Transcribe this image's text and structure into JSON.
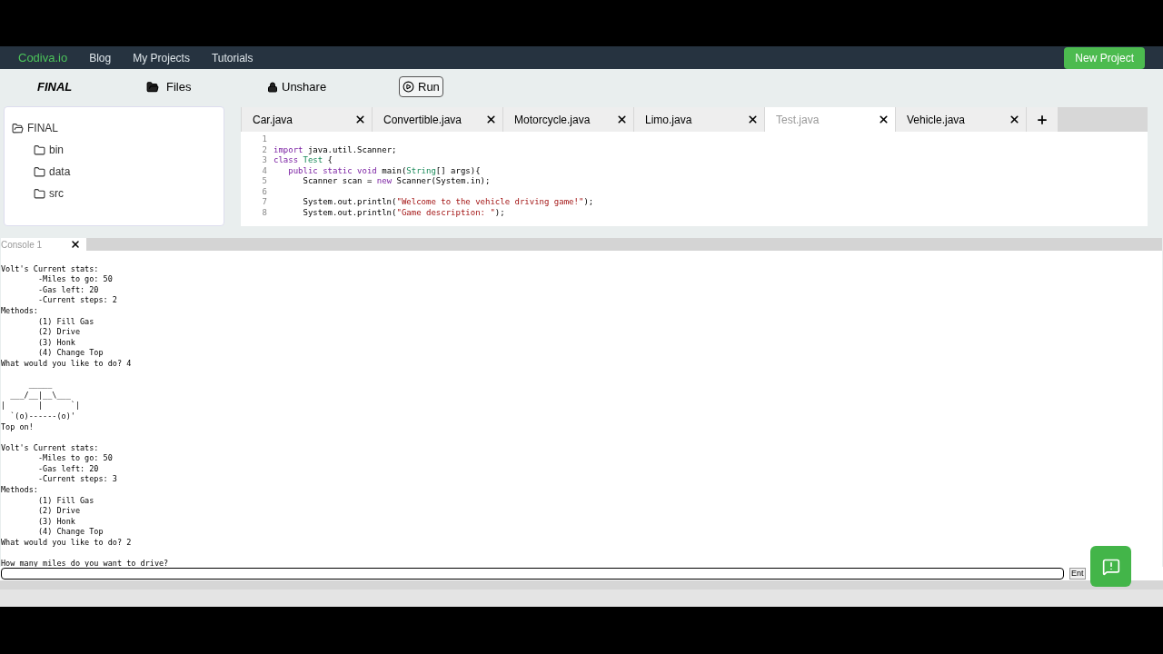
{
  "nav": {
    "brand": "Codiva.io",
    "links": [
      "Blog",
      "My Projects",
      "Tutorials"
    ],
    "new_project": "New Project"
  },
  "toolbar": {
    "project": "FINAL",
    "files": "Files",
    "unshare": "Unshare",
    "run": "Run"
  },
  "tree": {
    "label": "FINAL",
    "children": [
      {
        "label": "bin"
      },
      {
        "label": "data"
      },
      {
        "label": "src"
      }
    ]
  },
  "tabs": [
    {
      "label": "Car.java",
      "selected": false
    },
    {
      "label": "Convertible.java",
      "selected": false
    },
    {
      "label": "Motorcycle.java",
      "selected": false
    },
    {
      "label": "Limo.java",
      "selected": false
    },
    {
      "label": "Test.java",
      "selected": true
    },
    {
      "label": "Vehicle.java",
      "selected": false
    }
  ],
  "code": [
    {
      "number": "1"
    },
    {
      "number": "2",
      "tokens": [
        {
          "kind": "keyword",
          "text": "import"
        },
        {
          "kind": "plain",
          "text": " java.util.Scanner;"
        }
      ]
    },
    {
      "number": "3",
      "tokens": [
        {
          "kind": "keyword",
          "text": "class"
        },
        {
          "kind": "type",
          "text": " Test"
        },
        {
          "kind": "plain",
          "text": " {"
        }
      ]
    },
    {
      "number": "4",
      "tokens": [
        {
          "kind": "keyword",
          "text": "   public static void"
        },
        {
          "kind": "plain",
          "text": " main("
        },
        {
          "kind": "type",
          "text": "String"
        },
        {
          "kind": "plain",
          "text": "[] args){"
        }
      ]
    },
    {
      "number": "5",
      "tokens": [
        {
          "kind": "plain",
          "text": "      Scanner scan = "
        },
        {
          "kind": "keyword",
          "text": "new"
        },
        {
          "kind": "plain",
          "text": " Scanner(System.in);"
        }
      ]
    },
    {
      "number": "6"
    },
    {
      "number": "7",
      "tokens": [
        {
          "kind": "plain",
          "text": "      System.out.println("
        },
        {
          "kind": "string",
          "text": "\"Welcome to the vehicle driving game!\""
        },
        {
          "kind": "plain",
          "text": ");"
        }
      ]
    },
    {
      "number": "8",
      "tokens": [
        {
          "kind": "plain",
          "text": "      System.out.println("
        },
        {
          "kind": "string",
          "text": "\"Game description: \""
        },
        {
          "kind": "plain",
          "text": ");"
        }
      ]
    }
  ],
  "console": {
    "tab": "Console 1",
    "blocks": [
      {
        "lines": [
          "Volt's Current stats:",
          "        -Miles to go: 50",
          "        -Gas left: 20",
          "        -Current steps: 2",
          "Methods:",
          "        (1) Fill Gas",
          "        (2) Drive",
          "        (3) Honk",
          "        (4) Change Top",
          "What would you like to do? 4"
        ]
      },
      {
        "lines": [
          "      _____",
          "  ___/__|__\\___",
          "|       |      `|",
          "  `(o)------(o)'",
          "Top on!"
        ]
      },
      {
        "lines": [
          "Volt's Current stats:",
          "        -Miles to go: 50",
          "        -Gas left: 20",
          "        -Current steps: 3",
          "Methods:",
          "        (1) Fill Gas",
          "        (2) Drive",
          "        (3) Honk",
          "        (4) Change Top",
          "What would you like to do? 2"
        ]
      },
      {
        "lines": [
          "How many miles do you want to drive?"
        ]
      }
    ],
    "enter": "Ent"
  }
}
